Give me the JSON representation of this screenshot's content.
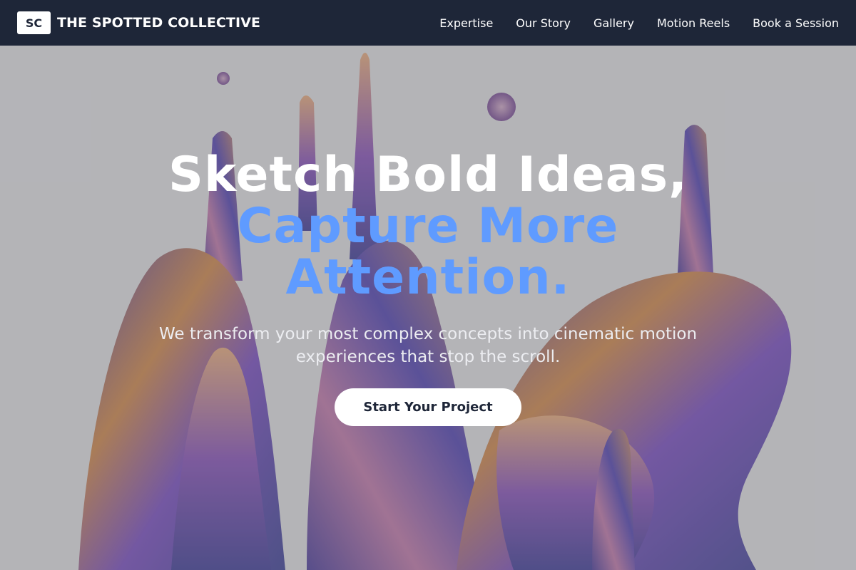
{
  "nav": {
    "logo_text": "SC",
    "brand_name": "THE SPOTTED COLLECTIVE",
    "links": [
      "Expertise",
      "Our Story",
      "Gallery",
      "Motion Reels",
      "Book a Session"
    ]
  },
  "hero": {
    "headline_line1": "Sketch Bold Ideas,",
    "headline_line2": "Capture More",
    "headline_line3": "Attention.",
    "subtext": "We transform your most complex concepts into cinematic motion experiences that stop the scroll.",
    "cta_label": "Start Your Project"
  },
  "colors": {
    "nav_bg": "#1e2638",
    "accent": "#5f9bff",
    "hero_tint": "#8f8f94"
  },
  "icons": {
    "hero_image": "liquid-splash-art"
  }
}
